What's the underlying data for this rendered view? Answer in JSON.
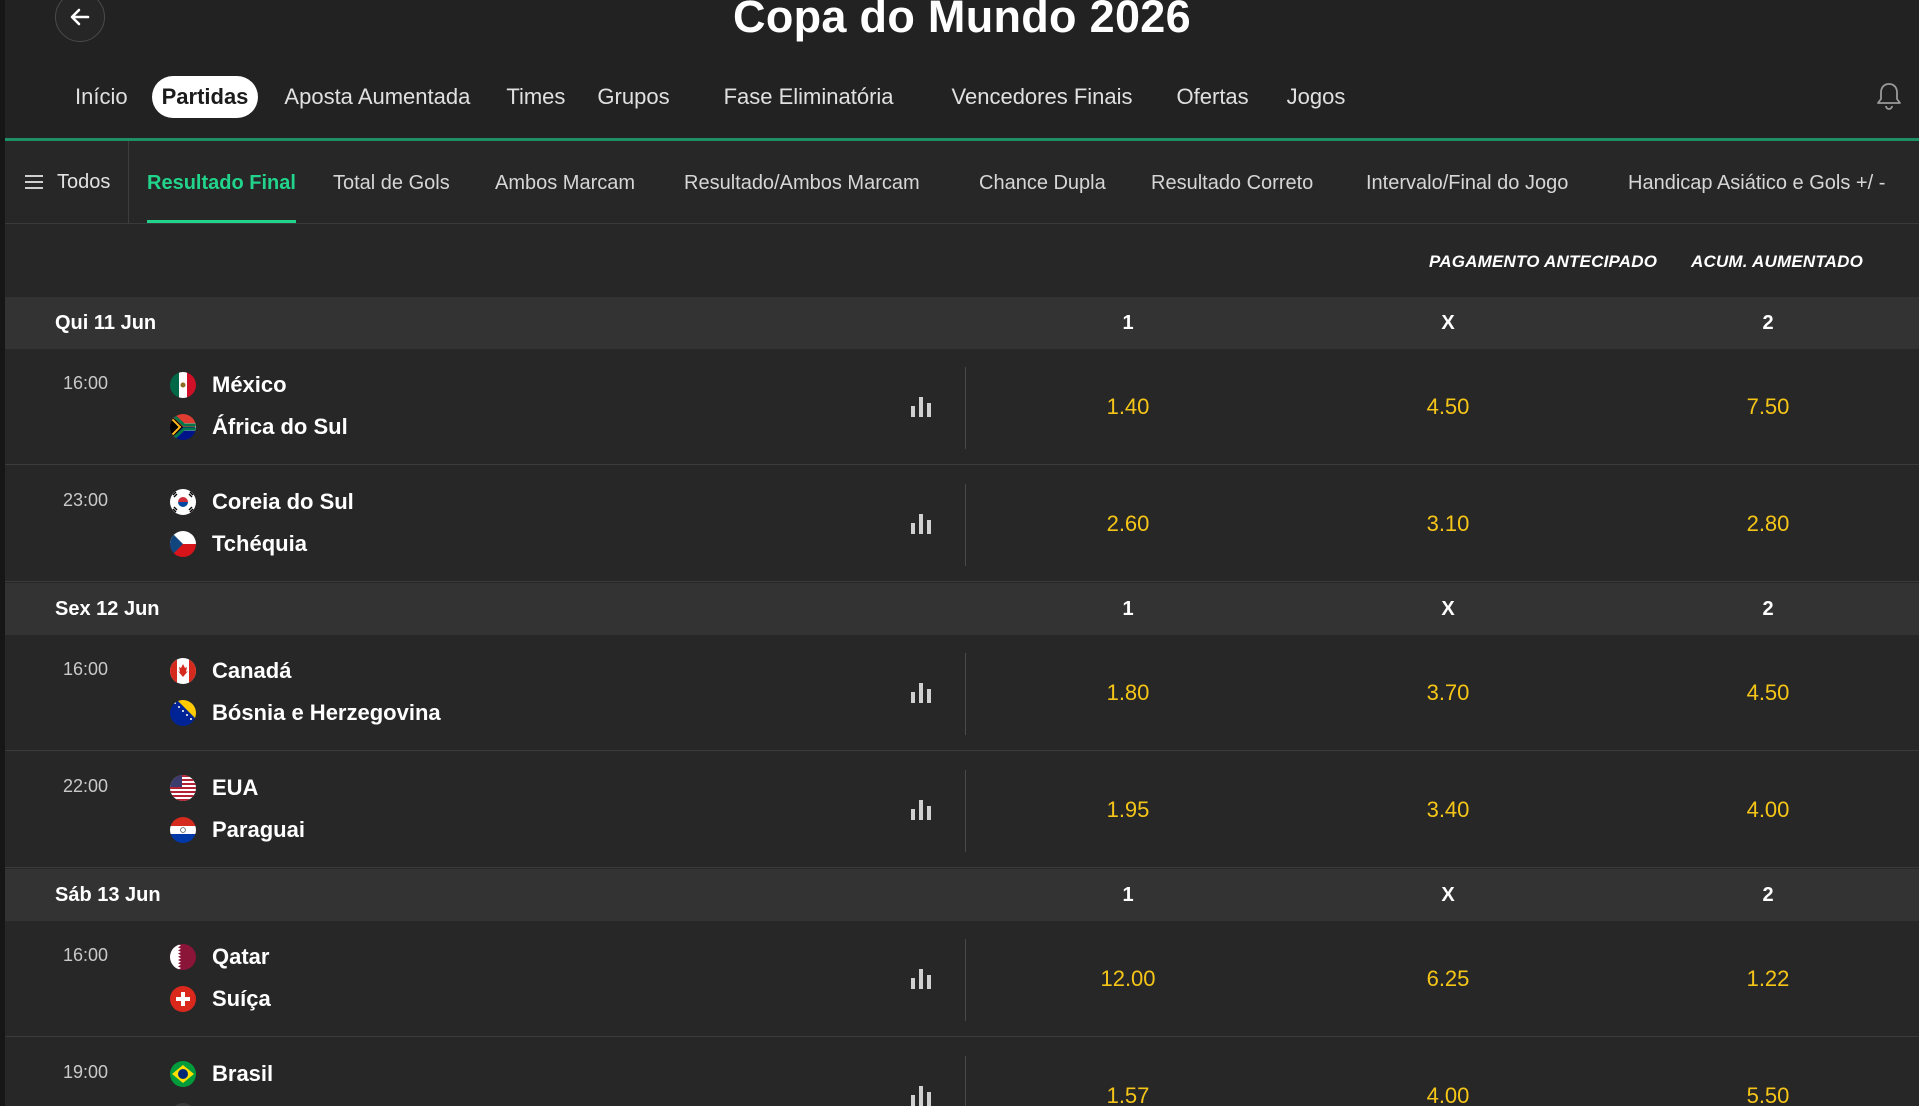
{
  "header": {
    "title": "Copa do Mundo 2026",
    "nav_tabs": [
      {
        "label": "Início"
      },
      {
        "label": "Partidas"
      },
      {
        "label": "Aposta Aumentada"
      },
      {
        "label": "Times"
      },
      {
        "label": "Grupos"
      },
      {
        "label": "Fase Eliminatória"
      },
      {
        "label": "Vencedores Finais"
      },
      {
        "label": "Ofertas"
      },
      {
        "label": "Jogos"
      }
    ]
  },
  "market_tabs": {
    "all_label": "Todos",
    "tabs": [
      {
        "label": "Resultado Final"
      },
      {
        "label": "Total de Gols"
      },
      {
        "label": "Ambos Marcam"
      },
      {
        "label": "Resultado/Ambos Marcam"
      },
      {
        "label": "Chance Dupla"
      },
      {
        "label": "Resultado Correto"
      },
      {
        "label": "Intervalo/Final do Jogo"
      },
      {
        "label": "Handicap Asiático e Gols +/ -"
      }
    ]
  },
  "column_headers": {
    "early_payout": "PAGAMENTO ANTECIPADO",
    "boosted_acca": "ACUM. AUMENTADO"
  },
  "outcome_labels": {
    "home": "1",
    "draw": "X",
    "away": "2"
  },
  "days": [
    {
      "label": "Qui 11 Jun"
    },
    {
      "label": "Sex 12 Jun"
    },
    {
      "label": "Sáb 13 Jun"
    }
  ],
  "matches": [
    {
      "time": "16:00",
      "home": "México",
      "away": "África do Sul",
      "odds": {
        "home": "1.40",
        "draw": "4.50",
        "away": "7.50"
      }
    },
    {
      "time": "23:00",
      "home": "Coreia do Sul",
      "away": "Tchéquia",
      "odds": {
        "home": "2.60",
        "draw": "3.10",
        "away": "2.80"
      }
    },
    {
      "time": "16:00",
      "home": "Canadá",
      "away": "Bósnia e Herzegovina",
      "odds": {
        "home": "1.80",
        "draw": "3.70",
        "away": "4.50"
      }
    },
    {
      "time": "22:00",
      "home": "EUA",
      "away": "Paraguai",
      "odds": {
        "home": "1.95",
        "draw": "3.40",
        "away": "4.00"
      }
    },
    {
      "time": "16:00",
      "home": "Qatar",
      "away": "Suíça",
      "odds": {
        "home": "12.00",
        "draw": "6.25",
        "away": "1.22"
      }
    },
    {
      "time": "19:00",
      "home": "Brasil",
      "away": "",
      "odds": {
        "home": "1.57",
        "draw": "4.00",
        "away": "5.50"
      }
    }
  ],
  "colors": {
    "accent_green": "#22d38b",
    "odds_yellow": "#f5c518",
    "background": "#272727",
    "day_header_bg": "#333333"
  },
  "icons": [
    "back-arrow-icon",
    "bell-icon",
    "menu-icon",
    "stats-icon"
  ]
}
